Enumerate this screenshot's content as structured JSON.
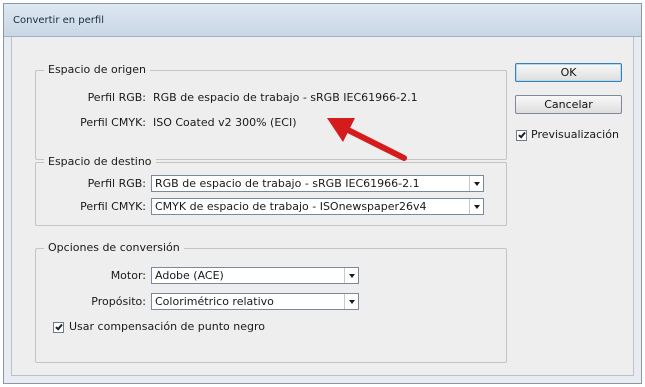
{
  "dialog": {
    "title": "Convertir en perfil"
  },
  "source": {
    "legend": "Espacio de origen",
    "rgb_label": "Perfil RGB:",
    "rgb_value": "RGB de espacio de trabajo - sRGB IEC61966-2.1",
    "cmyk_label": "Perfil CMYK:",
    "cmyk_value": "ISO Coated v2 300% (ECI)"
  },
  "destination": {
    "legend": "Espacio de destino",
    "rgb_label": "Perfil RGB:",
    "rgb_selected": "RGB de espacio de trabajo - sRGB IEC61966-2.1",
    "cmyk_label": "Perfil CMYK:",
    "cmyk_selected": "CMYK de espacio de trabajo - ISOnewspaper26v4"
  },
  "conversion": {
    "legend": "Opciones de conversión",
    "engine_label": "Motor:",
    "engine_selected": "Adobe (ACE)",
    "intent_label": "Propósito:",
    "intent_selected": "Colorimétrico relativo",
    "black_point_label": "Usar compensación de punto negro",
    "black_point_checked": true
  },
  "buttons": {
    "ok": "OK",
    "cancel": "Cancelar",
    "preview_label": "Previsualización",
    "preview_checked": true
  },
  "annotation": {
    "arrow_color": "#d41c1c",
    "icon": "red-arrow-icon"
  }
}
